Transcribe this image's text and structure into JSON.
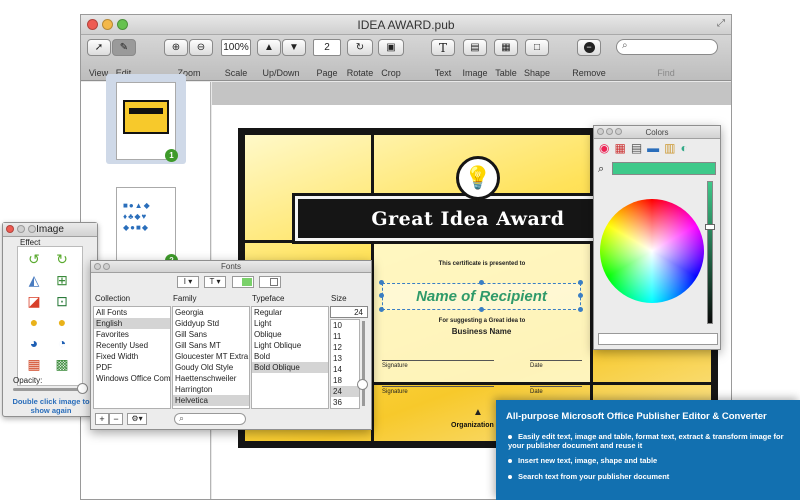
{
  "window": {
    "title": "IDEA AWARD.pub"
  },
  "toolbar": {
    "zoom_value": "100%",
    "page_value": "2",
    "search_placeholder": "",
    "labels": {
      "view": "View",
      "edit": "Edit",
      "zoom": "Zoom",
      "scale": "Scale",
      "updown": "Up/Down",
      "page": "Page",
      "rotate": "Rotate",
      "crop": "Crop",
      "text": "Text",
      "image": "Image",
      "table": "Table",
      "shape": "Shape",
      "remove": "Remove",
      "find": "Find"
    }
  },
  "sidebar": {
    "pages": [
      {
        "badge": "1"
      },
      {
        "badge": "2"
      }
    ]
  },
  "certificate": {
    "title": "Great Idea Award",
    "presented": "This certificate is presented to",
    "recipient": "Name of Recipient",
    "suggesting": "For suggesting a Great idea to",
    "business": "Business Name",
    "signature_label": "Signature",
    "date_label": "Date",
    "organization": "Organization"
  },
  "image_panel": {
    "title": "Image",
    "effect_label": "Effect",
    "opacity_label": "Opacity:",
    "hint": "Double click image to show again",
    "effect_icons": [
      "rotate-left-icon",
      "rotate-right-icon",
      "flip-horizontal-icon",
      "enhance-icon",
      "color-swap-icon",
      "crop-icon",
      "bulb-icon",
      "bulb-icon-2",
      "pie-icon",
      "pie-icon-2",
      "grid-icon",
      "grid-add-icon"
    ]
  },
  "fonts_panel": {
    "title": "Fonts",
    "headers": {
      "collection": "Collection",
      "family": "Family",
      "typeface": "Typeface",
      "size": "Size"
    },
    "collections": [
      "All Fonts",
      "English",
      "Favorites",
      "Recently Used",
      "Fixed Width",
      "PDF",
      "Windows Office Comp"
    ],
    "families": [
      "Georgia",
      "Giddyup Std",
      "Gill Sans",
      "Gill Sans MT",
      "Gloucester MT Extra C",
      "Goudy Old Style",
      "Haettenschweiler",
      "Harrington",
      "Helvetica"
    ],
    "typefaces": [
      "Regular",
      "Light",
      "Oblique",
      "Light Oblique",
      "Bold",
      "Bold Oblique"
    ],
    "size_value": "24",
    "sizes": [
      "10",
      "11",
      "12",
      "13",
      "14",
      "18",
      "24",
      "36"
    ]
  },
  "colors_panel": {
    "title": "Colors",
    "accent": "#3ec98a"
  },
  "promo": {
    "heading": "All-purpose Microsoft Office Publisher Editor & Converter",
    "bullets": [
      "Easily edit text, image and table, format text, extract & transform image for your publisher document and reuse it",
      "Insert new text, image, shape and table",
      "Search text from your publisher document"
    ]
  },
  "colors": {
    "accent": "#1270b0",
    "gold": "#f7c92b",
    "recipient": "#2f9a6a"
  }
}
